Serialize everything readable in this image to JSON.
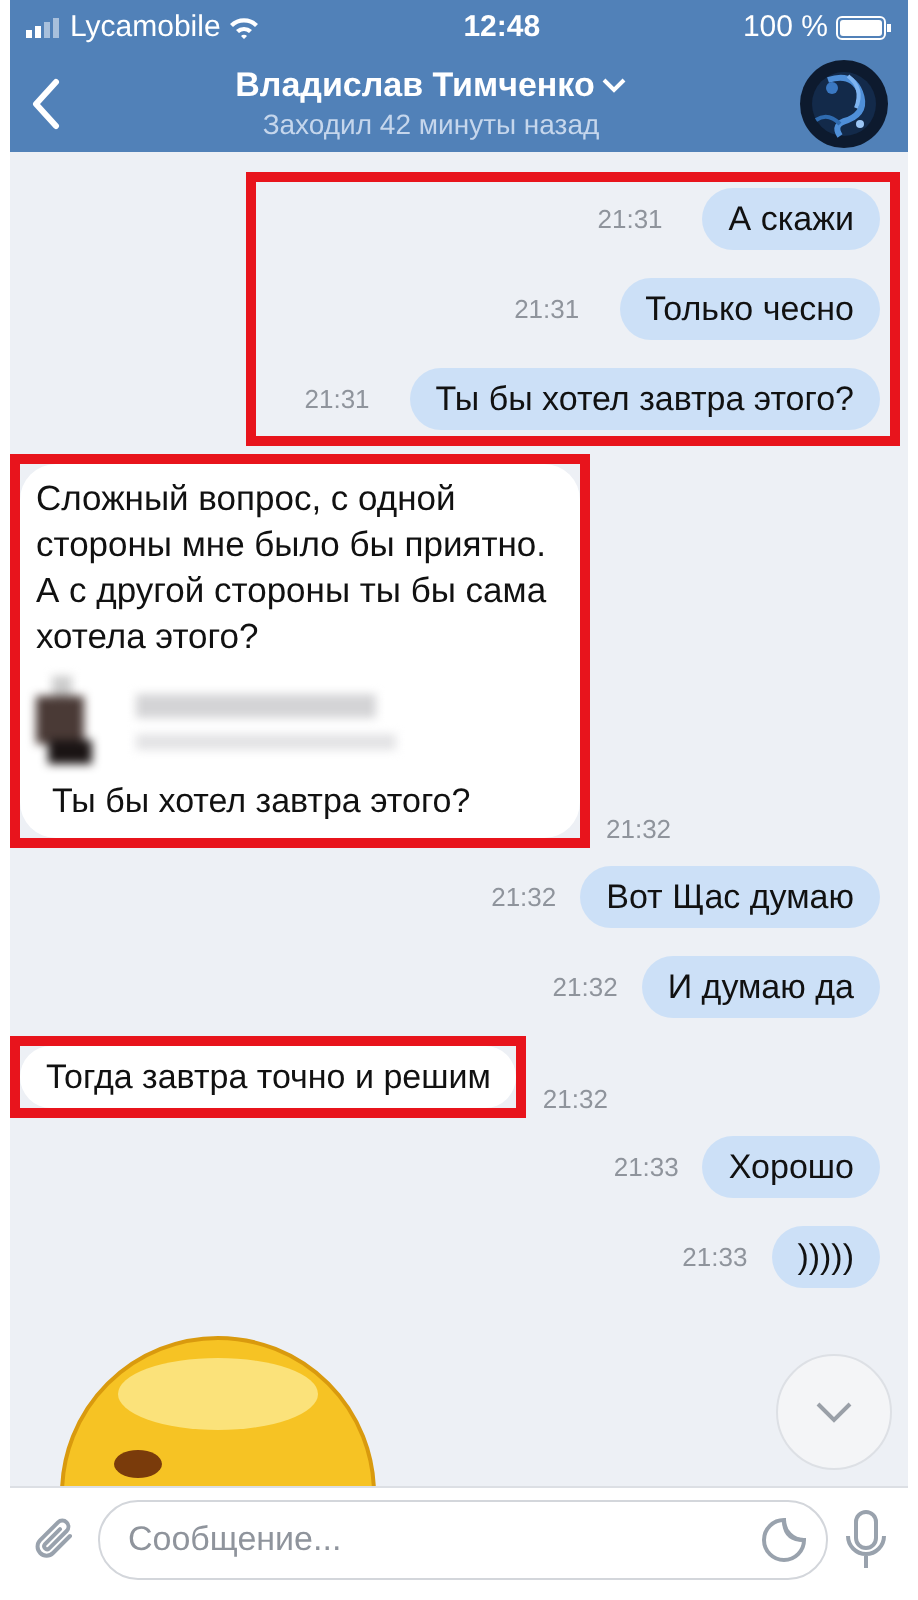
{
  "status_bar": {
    "carrier": "Lycamobile",
    "time": "12:48",
    "battery": "100 %"
  },
  "header": {
    "name": "Владислав Тимченко",
    "status": "Заходил 42 минуты назад"
  },
  "blocks": [
    {
      "kind": "outgoing",
      "highlighted": true,
      "messages": [
        {
          "text": "А скажи",
          "time": "21:31"
        },
        {
          "text": "Только чесно",
          "time": "21:31"
        },
        {
          "text": "Ты бы хотел завтра этого?",
          "time": "21:31"
        }
      ]
    },
    {
      "kind": "incoming",
      "highlighted": true,
      "messages": [
        {
          "text": "Сложный вопрос, с одной стороны мне было бы приятно. А с другой стороны ты бы сама хотела этого?",
          "time": "21:32",
          "forwarded": {
            "text": "Ты бы хотел завтра этого?"
          }
        }
      ]
    },
    {
      "kind": "outgoing",
      "highlighted": false,
      "messages": [
        {
          "text": "Вот Щас думаю",
          "time": "21:32"
        },
        {
          "text": "И думаю да",
          "time": "21:32"
        }
      ]
    },
    {
      "kind": "incoming",
      "highlighted": true,
      "messages": [
        {
          "text": "Тогда завтра точно и решим",
          "time": "21:32"
        }
      ]
    },
    {
      "kind": "outgoing",
      "highlighted": false,
      "messages": [
        {
          "text": "Хорошо",
          "time": "21:33"
        },
        {
          "text": ")))))",
          "time": "21:33"
        }
      ]
    }
  ],
  "composer": {
    "placeholder": "Сообщение..."
  }
}
